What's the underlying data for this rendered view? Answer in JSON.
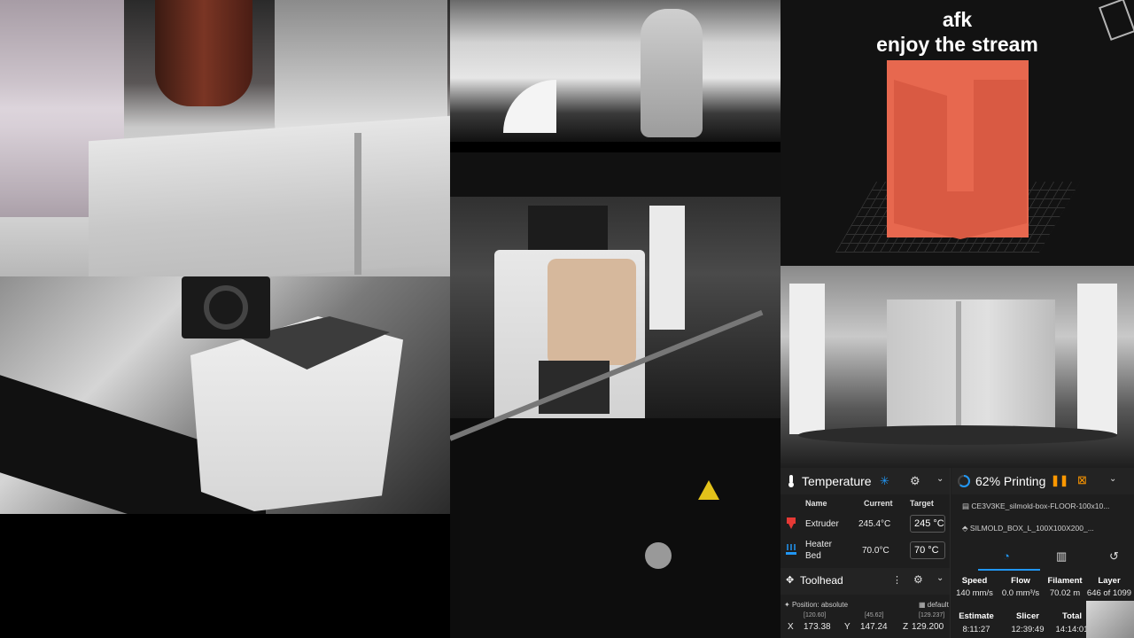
{
  "overlay": {
    "line1": "afk",
    "line2": "enjoy the stream"
  },
  "temperature": {
    "title": "Temperature",
    "col_name": "Name",
    "col_current": "Current",
    "col_target": "Target",
    "rows": [
      {
        "name": "Extruder",
        "current": "245.4°C",
        "target": "245",
        "unit": "°C"
      },
      {
        "name": "Heater Bed",
        "current": "70.0°C",
        "target": "70",
        "unit": "°C"
      }
    ]
  },
  "toolhead": {
    "title": "Toolhead",
    "position_label": "Position: absolute",
    "preset": "default",
    "x": {
      "label": "X",
      "target": "[120.60]",
      "value": "173.38"
    },
    "y": {
      "label": "Y",
      "target": "[45.62]",
      "value": "147.24"
    },
    "z": {
      "label": "Z",
      "target": "[129.237]",
      "value": "129.200"
    }
  },
  "printing": {
    "status": "62% Printing",
    "progress": 0.62,
    "file1": "CE3V3KE_silmold-box-FLOOR-100x10...",
    "file2": "SILMOLD_BOX_L_100X100X200_...",
    "stats": [
      {
        "label": "Speed",
        "value": "140 mm/s"
      },
      {
        "label": "Flow",
        "value": "0.0 mm³/s"
      },
      {
        "label": "Filament",
        "value": "70.02 m"
      },
      {
        "label": "Layer",
        "value": "646 of 1099"
      }
    ],
    "times": [
      {
        "label": "Estimate",
        "value": "8:11:27"
      },
      {
        "label": "Slicer",
        "value": "12:39:49"
      },
      {
        "label": "Total",
        "value": "14:14:01"
      }
    ]
  },
  "colors": {
    "accent": "#2196f3",
    "pause": "#ff9800",
    "heater": "#e53935",
    "bed": "#2196f3",
    "model": "#e7684f"
  }
}
